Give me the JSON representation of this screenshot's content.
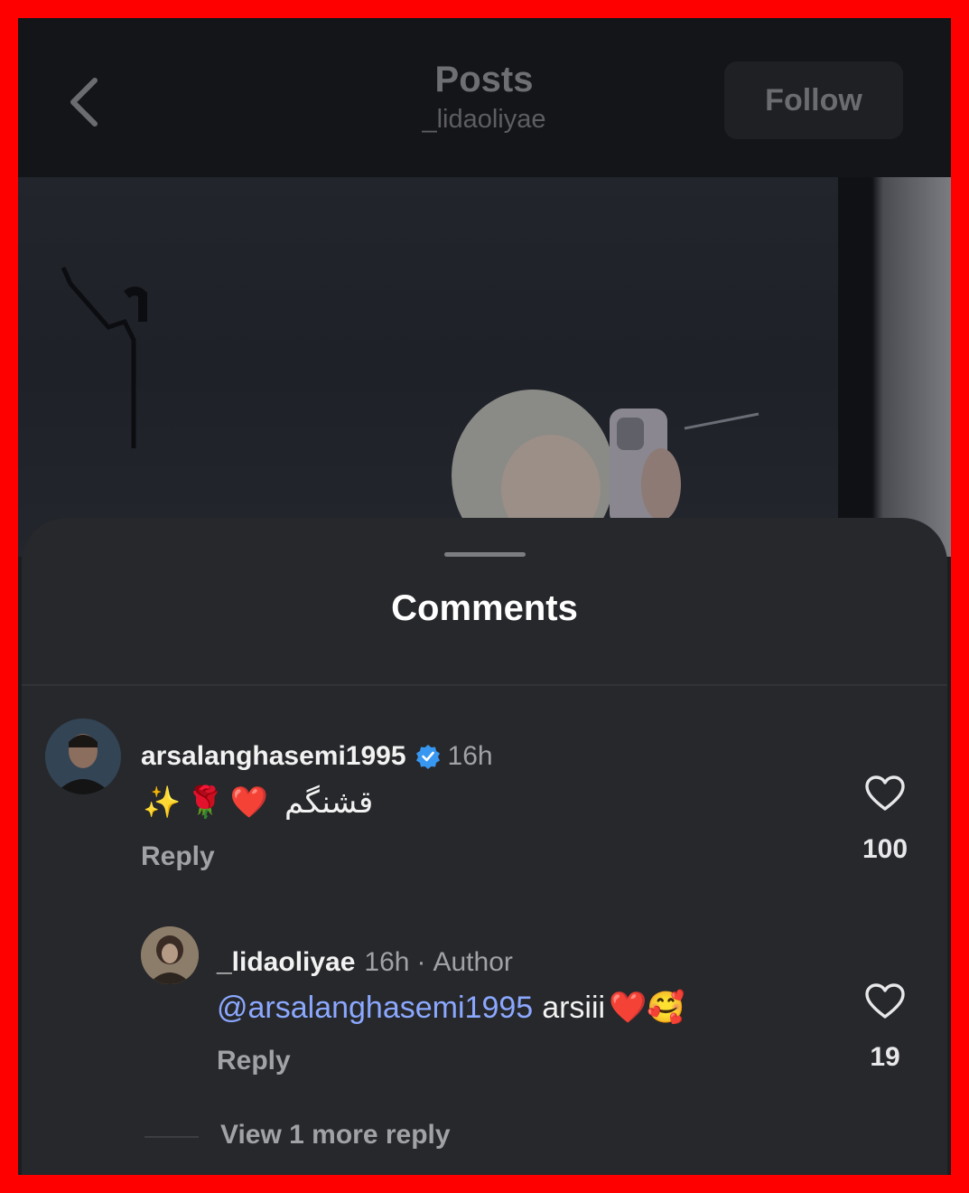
{
  "header": {
    "title": "Posts",
    "subtitle": "_lidaoliyae",
    "follow_label": "Follow"
  },
  "sheet": {
    "title": "Comments"
  },
  "comments": [
    {
      "username": "arsalanghasemi1995",
      "verified": true,
      "time": "16h",
      "text": "قشنگم",
      "emojis": "✨🌹❤️",
      "reply_label": "Reply",
      "likes": "100"
    }
  ],
  "reply": {
    "username": "_lidaoliyae",
    "time": "16h",
    "separator": "·",
    "author_label": "Author",
    "mention": "@arsalanghasemi1995",
    "text": "arsiii",
    "emojis": "❤️🥰",
    "reply_label": "Reply",
    "likes": "19"
  },
  "view_more": "View 1 more reply",
  "icons": [
    "back-chevron-icon",
    "verified-badge-icon",
    "heart-icon"
  ],
  "colors": {
    "background": "#1c1d20",
    "sheet": "#27282b",
    "mention": "#8ba8ff",
    "verified": "#3897f0",
    "border": "#ff0000"
  }
}
